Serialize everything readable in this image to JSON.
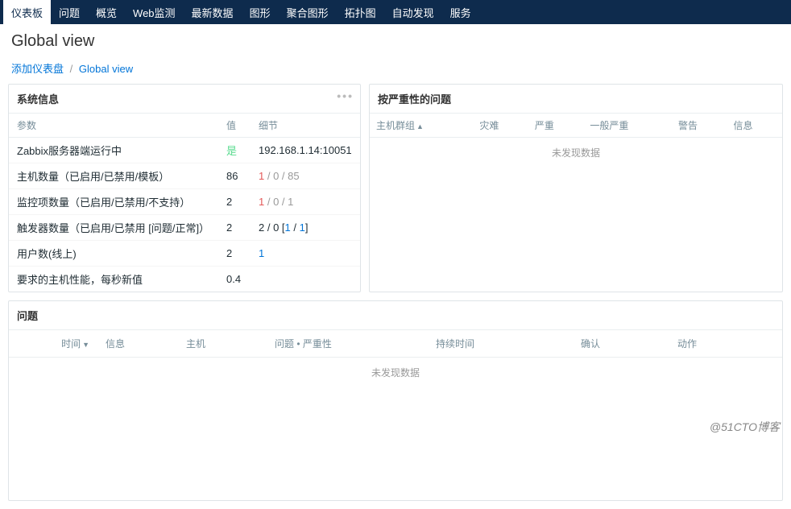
{
  "nav": {
    "items": [
      {
        "label": "仪表板",
        "active": true
      },
      {
        "label": "问题",
        "active": false
      },
      {
        "label": "概览",
        "active": false
      },
      {
        "label": "Web监测",
        "active": false
      },
      {
        "label": "最新数据",
        "active": false
      },
      {
        "label": "图形",
        "active": false
      },
      {
        "label": "聚合图形",
        "active": false
      },
      {
        "label": "拓扑图",
        "active": false
      },
      {
        "label": "自动发现",
        "active": false
      },
      {
        "label": "服务",
        "active": false
      }
    ]
  },
  "page_title": "Global view",
  "breadcrumb": {
    "add_dashboard": "添加仪表盘",
    "current": "Global view"
  },
  "sysinfo": {
    "title": "系统信息",
    "headers": {
      "param": "参数",
      "value": "值",
      "detail": "细节"
    },
    "rows": [
      {
        "param": "Zabbix服务器端运行中",
        "value": "是",
        "value_class": "val-green",
        "detail": "192.168.1.14:10051"
      },
      {
        "param": "主机数量（已启用/已禁用/模板）",
        "value": "86",
        "detail_parts": [
          {
            "t": "1",
            "c": "val-red"
          },
          {
            "t": " / ",
            "c": "val-grey"
          },
          {
            "t": "0",
            "c": "val-grey"
          },
          {
            "t": " / ",
            "c": "val-grey"
          },
          {
            "t": "85",
            "c": "val-grey"
          }
        ]
      },
      {
        "param": "监控项数量（已启用/已禁用/不支持）",
        "value": "2",
        "detail_parts": [
          {
            "t": "1",
            "c": "val-red"
          },
          {
            "t": " / ",
            "c": "val-grey"
          },
          {
            "t": "0",
            "c": "val-grey"
          },
          {
            "t": " / ",
            "c": "val-grey"
          },
          {
            "t": "1",
            "c": "val-grey"
          }
        ]
      },
      {
        "param": "触发器数量（已启用/已禁用 [问题/正常]）",
        "value": "2",
        "detail_parts": [
          {
            "t": "2 / 0 [",
            "c": ""
          },
          {
            "t": "1",
            "c": "val-link"
          },
          {
            "t": " / ",
            "c": ""
          },
          {
            "t": "1",
            "c": "val-link"
          },
          {
            "t": "]",
            "c": ""
          }
        ]
      },
      {
        "param": "用户数(线上)",
        "value": "2",
        "detail_parts": [
          {
            "t": "1",
            "c": "val-link"
          }
        ]
      },
      {
        "param": "要求的主机性能，每秒新值",
        "value": "0.4",
        "detail": ""
      }
    ]
  },
  "severity": {
    "title": "按严重性的问题",
    "headers": [
      "主机群组",
      "灾难",
      "严重",
      "一般严重",
      "警告",
      "信息"
    ],
    "no_data": "未发现数据"
  },
  "problems": {
    "title": "问题",
    "headers": [
      "时间",
      "信息",
      "主机",
      "问题 • 严重性",
      "持续时间",
      "确认",
      "动作"
    ],
    "no_data": "未发现数据"
  },
  "watermark": "@51CTO博客"
}
